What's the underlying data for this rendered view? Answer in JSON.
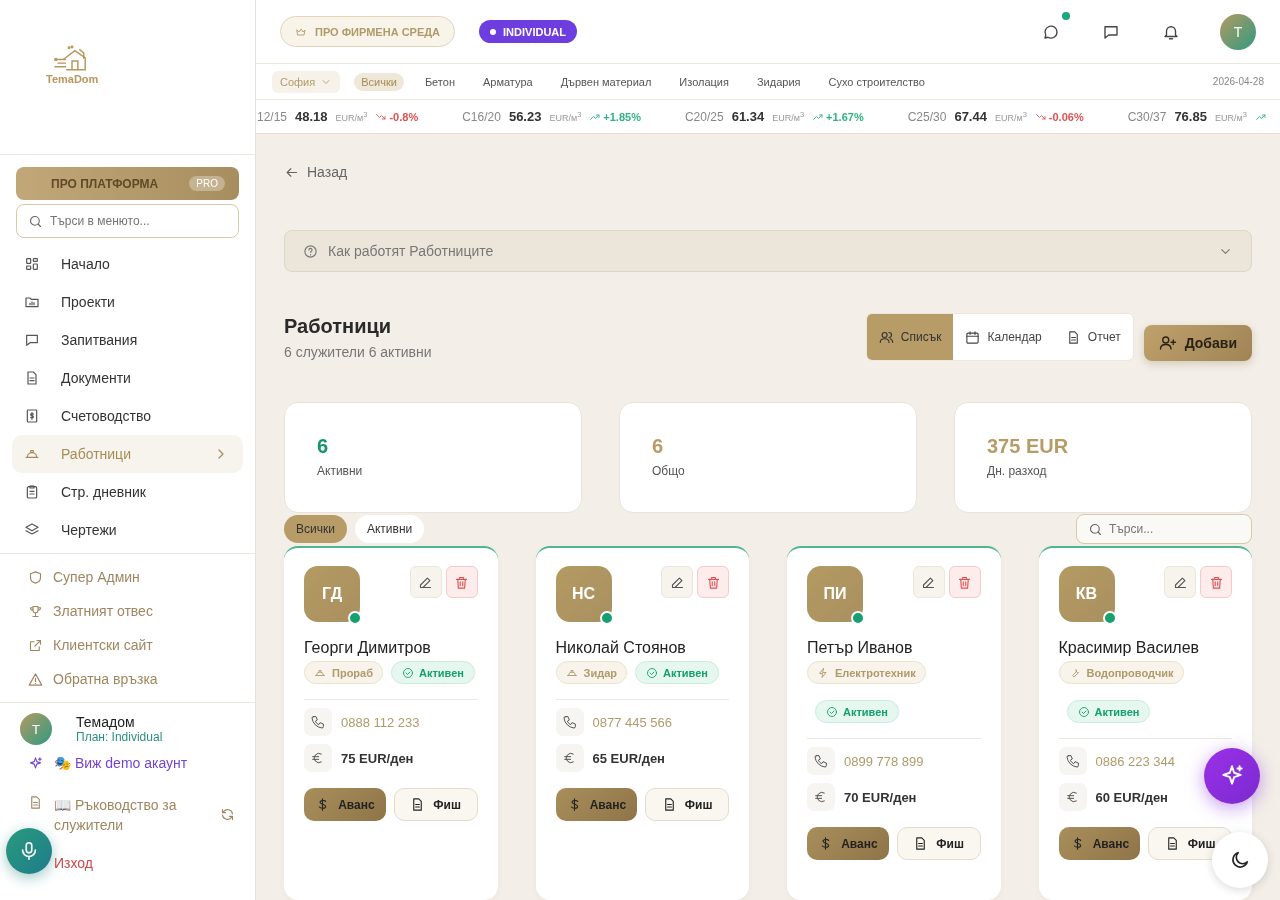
{
  "logo": {
    "text": "TemaDom"
  },
  "header": {
    "pro_badge": "ПРО ФИРМЕНА СРЕДА",
    "plan_badge": "INDIVIDUAL",
    "chat_unread": true,
    "avatar": "Т"
  },
  "filters": {
    "city": "София",
    "categories": [
      {
        "label": "Всички",
        "selected": true
      },
      {
        "label": "Бетон",
        "selected": false
      },
      {
        "label": "Арматура",
        "selected": false
      },
      {
        "label": "Дървен материал",
        "selected": false
      },
      {
        "label": "Изолация",
        "selected": false
      },
      {
        "label": "Зидария",
        "selected": false
      },
      {
        "label": "Сухо строителство",
        "selected": false
      }
    ],
    "date": "2026-04-28"
  },
  "ticker": [
    {
      "code": "12/15",
      "price": "48.18",
      "unit": "EUR/м$^{3}$",
      "change": "-0.8%",
      "kind": "down"
    },
    {
      "code": "C16/20",
      "price": "56.23",
      "unit": "EUR/м$^{3}$",
      "change": "+1.85%",
      "kind": "up"
    },
    {
      "code": "C20/25",
      "price": "61.34",
      "unit": "EUR/м$^{3}$",
      "change": "+1.67%",
      "kind": "up"
    },
    {
      "code": "C25/30",
      "price": "67.44",
      "unit": "EUR/м$^{3}$",
      "change": "-0.06%",
      "kind": "down"
    },
    {
      "code": "C30/37",
      "price": "76.85",
      "unit": "EUR/м$^{3}$",
      "kind": "up"
    }
  ],
  "sidebar": {
    "pro_button": "ПРО ПЛАТФОРМА",
    "pro_tag": "PRO",
    "search": {
      "placeholder": "Търси в менюто..."
    },
    "items": [
      {
        "label": "Начало",
        "selected": false
      },
      {
        "label": "Проекти",
        "selected": false
      },
      {
        "label": "Запитвания",
        "selected": false
      },
      {
        "label": "Документи",
        "selected": false
      },
      {
        "label": "Счетоводство",
        "selected": false
      },
      {
        "label": "Работници",
        "selected": true
      },
      {
        "label": "Стр. дневник",
        "selected": false
      },
      {
        "label": "Чертежи",
        "selected": false
      }
    ],
    "extra_items": [
      "Супер Админ",
      "Златният отвес",
      "Клиентски сайт",
      "Обратна връзка"
    ],
    "user": {
      "avatar": "Т",
      "name": "Темадом",
      "plan": "План: Individual"
    },
    "demo_link": "🎭 Виж demo акаунт",
    "guide_link": "📖 Ръководство за служители",
    "logout": "Изход"
  },
  "back": "Назад",
  "help": "Как работят Работниците",
  "page": {
    "title": "Работници",
    "subtitle": "6 служители 6 активни",
    "views": [
      {
        "label": "Списък",
        "selected": true
      },
      {
        "label": "Календар",
        "selected": false
      },
      {
        "label": "Отчет",
        "selected": false
      }
    ],
    "add_button": "Добави"
  },
  "stats": [
    {
      "value": "6",
      "label": "Активни",
      "kind": "green"
    },
    {
      "value": "6",
      "label": "Общо",
      "kind": "gold"
    },
    {
      "value": "375 EUR",
      "label": "Дн. разход",
      "kind": "gold"
    }
  ],
  "chips": [
    {
      "label": "Всички",
      "selected": true
    },
    {
      "label": "Активни",
      "selected": false
    }
  ],
  "search": {
    "placeholder": "Търси..."
  },
  "workers": [
    {
      "initials": "ГД",
      "name": "Георги Димитров",
      "role": "Прораб",
      "kind": "builder",
      "status": "Активен",
      "phone": "0888 112 233",
      "rate": "75 EUR/ден",
      "advance": "Аванс",
      "slip": "Фиш"
    },
    {
      "initials": "НС",
      "name": "Николай Стоянов",
      "role": "Зидар",
      "kind": "builder",
      "status": "Активен",
      "phone": "0877 445 566",
      "rate": "65 EUR/ден",
      "advance": "Аванс",
      "slip": "Фиш"
    },
    {
      "initials": "ПИ",
      "name": "Петър Иванов",
      "role": "Електротехник",
      "kind": "electric",
      "status": "Активен",
      "phone": "0899 778 899",
      "rate": "70 EUR/ден",
      "advance": "Аванс",
      "slip": "Фиш"
    },
    {
      "initials": "КВ",
      "name": "Красимир Василев",
      "role": "Водопроводчик",
      "kind": "plumbing",
      "status": "Активен",
      "phone": "0886 223 344",
      "rate": "60 EUR/ден",
      "advance": "Аванс",
      "slip": "Фиш"
    }
  ]
}
